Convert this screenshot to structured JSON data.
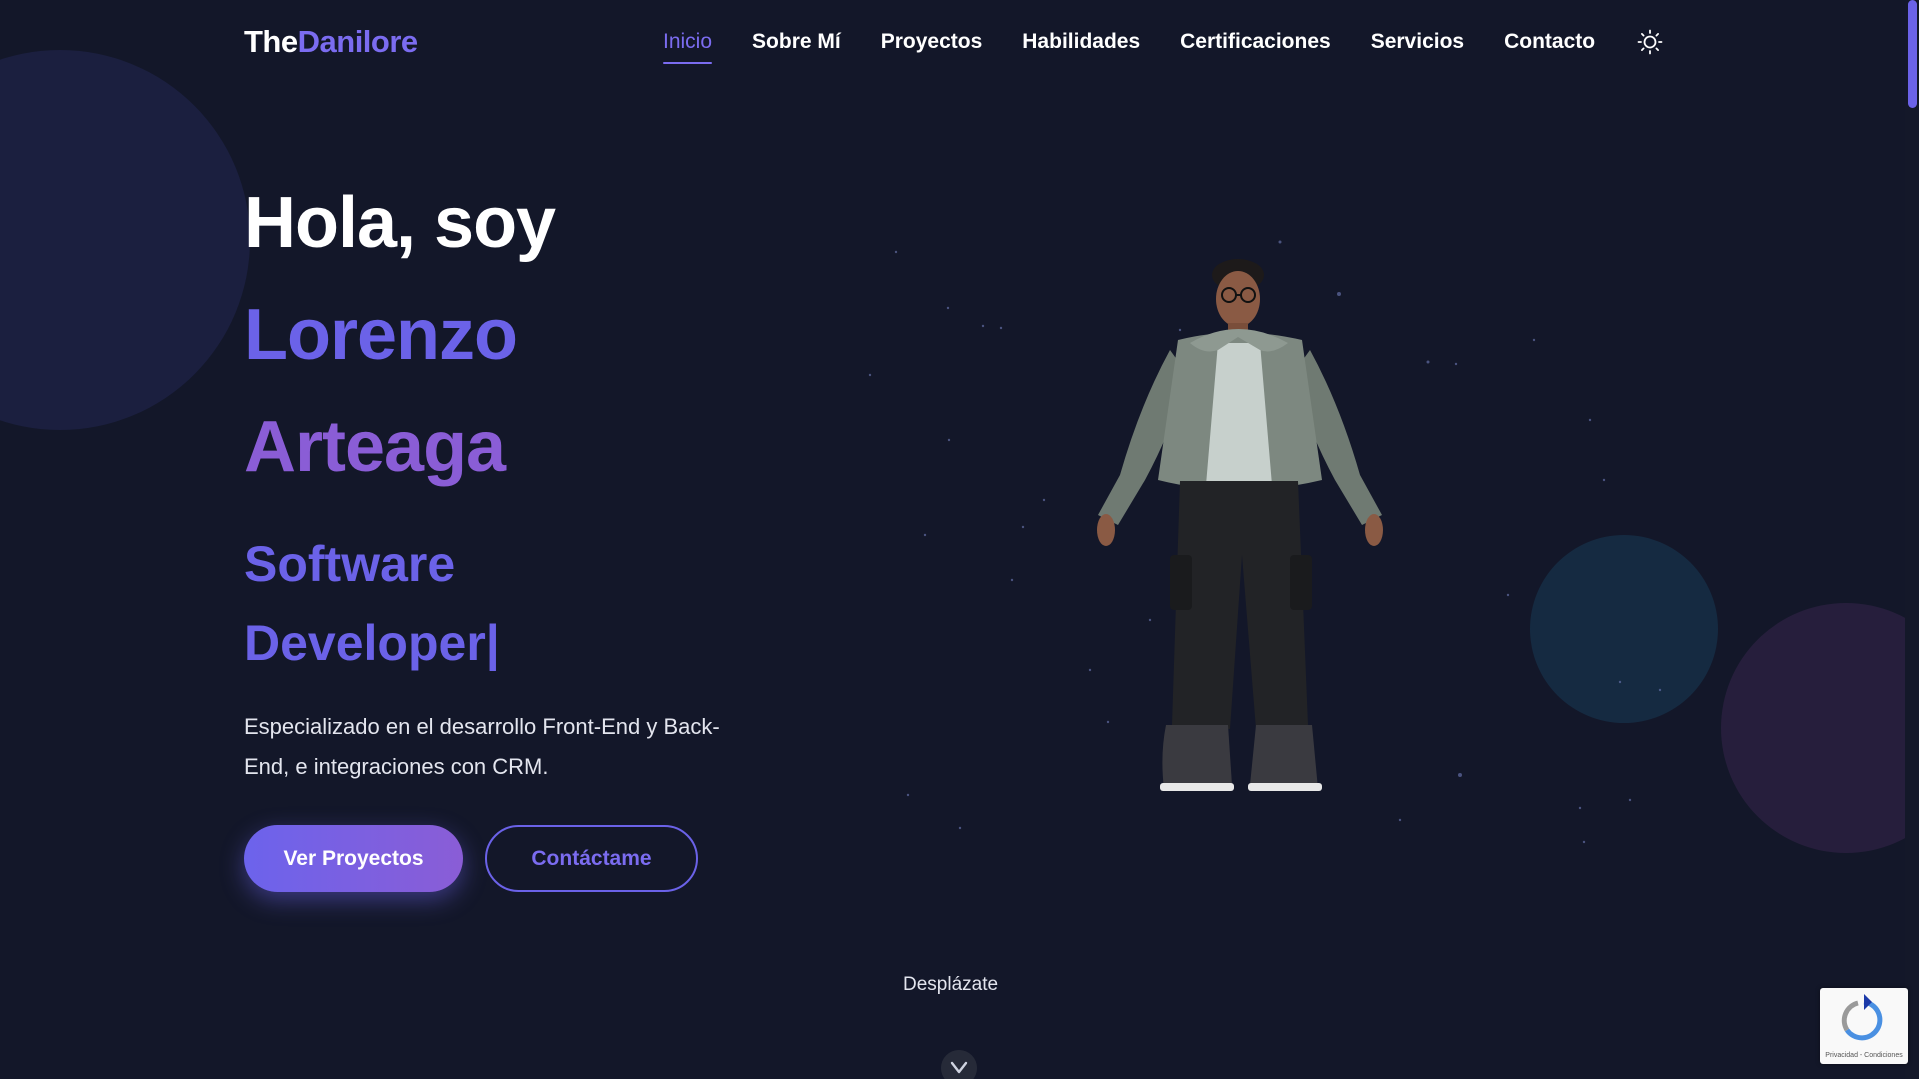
{
  "logo": {
    "part_a": "The",
    "part_b": "Danilore"
  },
  "nav": {
    "items": [
      {
        "label": "Inicio",
        "active": true
      },
      {
        "label": "Sobre Mí",
        "active": false
      },
      {
        "label": "Proyectos",
        "active": false
      },
      {
        "label": "Habilidades",
        "active": false
      },
      {
        "label": "Certificaciones",
        "active": false
      },
      {
        "label": "Servicios",
        "active": false
      },
      {
        "label": "Contacto",
        "active": false
      }
    ],
    "theme_icon": "sun-icon"
  },
  "hero": {
    "greeting": "Hola, soy",
    "first_name": "Lorenzo",
    "last_name": "Arteaga",
    "role_line1": "Software",
    "role_line2": "Developer|",
    "description": "Especializado en el desarrollo Front-End y Back-End, e integraciones con CRM.",
    "primary_button": "Ver Proyectos",
    "secondary_button": "Contáctame"
  },
  "scroll": {
    "label": "Desplázate",
    "icon": "chevron-down-icon"
  },
  "recaptcha": {
    "text": "Privacidad - Condiciones",
    "icon": "recaptcha-icon"
  },
  "colors": {
    "background": "#131729",
    "accent": "#6b62e8",
    "accent_purple": "#8a5dd6",
    "text": "#ffffff"
  }
}
